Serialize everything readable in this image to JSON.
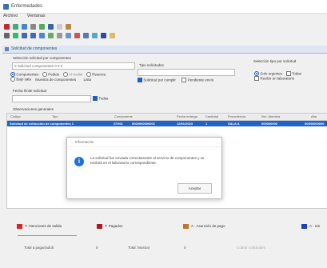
{
  "window": {
    "title": "Enfermedades"
  },
  "menu": [
    "Archivo",
    "Ventanas"
  ],
  "inner_window": {
    "title": "Solicitud de componentes"
  },
  "form": {
    "section_label": "Selección solicitud por componentes",
    "first_input_value": "0 Solicitud componentes 0 0 0",
    "radios": [
      "Componentes",
      "Pedido",
      "Al recibir",
      "Reserva",
      "Bajo sala",
      "Muestra de componentes",
      "Lista"
    ],
    "select_label": "Tipo solicitudes",
    "checkbox_1": "Solicitud por cumplir",
    "checkbox_2": "Pendiente envío",
    "right_label": "Selección tipo por solicitud",
    "right_radio_1": "Solo urgentes",
    "right_radio_2": "Todas",
    "right_check": "Recibir en laboratorio",
    "date_label": "Fecha límite solicitud",
    "update_label": "Todas"
  },
  "grid": {
    "section_label": "Observaciones generales",
    "columns": [
      "Código",
      "Tipo",
      "Componente",
      "Fecha entrega",
      "Cantidad",
      "Procedencia",
      "Nro. Muestra",
      "Alta"
    ],
    "row": [
      "Solicitud de extracción de componentes 1",
      "ST001",
      "0000000000001",
      "12/01/2023",
      "1",
      "SALA A",
      "000000000",
      "00/00/000000"
    ]
  },
  "dialog": {
    "title": "Información",
    "icon": "info-icon",
    "message": "La solicitud fue enviada correctamente al servicio de componentes y se recibirá en el laboratorio correspondiente.",
    "button": "Aceptar"
  },
  "legend": [
    {
      "label": "T. Atenciones de salida",
      "color": "#d9252a"
    },
    {
      "label": "T. Pagados",
      "color": "#b01820"
    },
    {
      "label": "A - Asunción de pago",
      "color": "#c7722a"
    },
    {
      "label": "A - Sin",
      "color": "#1a3fc0"
    }
  ],
  "totals": [
    {
      "label": "Total a pagar/adult",
      "value": "0"
    },
    {
      "label": "Total: Mostrar",
      "value": "0"
    },
    {
      "label": "Cobrar solicitudes",
      "value": ""
    }
  ]
}
